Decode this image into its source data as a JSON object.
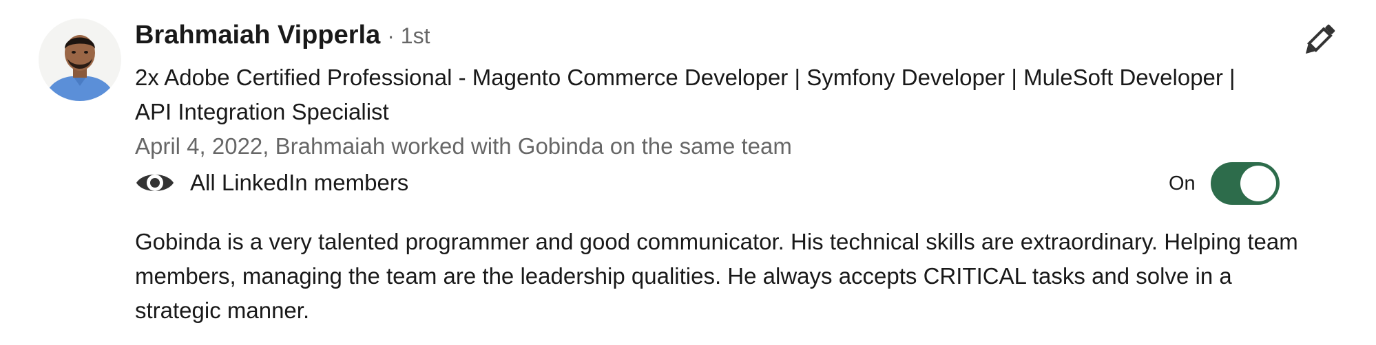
{
  "recommendation": {
    "recommender_name": "Brahmaiah Vipperla",
    "connection_degree": "· 1st",
    "headline": "2x Adobe Certified Professional - Magento Commerce Developer | Symfony Developer | MuleSoft Developer | API Integration Specialist",
    "relationship_line": "April 4, 2022, Brahmaiah worked with Gobinda on the same team",
    "visibility_label": "All LinkedIn members",
    "toggle_label": "On",
    "toggle_state": "on",
    "text": "Gobinda is a very talented programmer and good communicator. His technical skills are extraordinary. Helping team members, managing the team are the leadership qualities. He always accepts CRITICAL tasks and solve in a strategic manner."
  },
  "icons": {
    "visibility": "eye-icon",
    "edit": "pencil-icon"
  },
  "colors": {
    "toggle_on": "#2d6c4b",
    "secondary_text": "#666666",
    "primary_text": "#191919"
  }
}
